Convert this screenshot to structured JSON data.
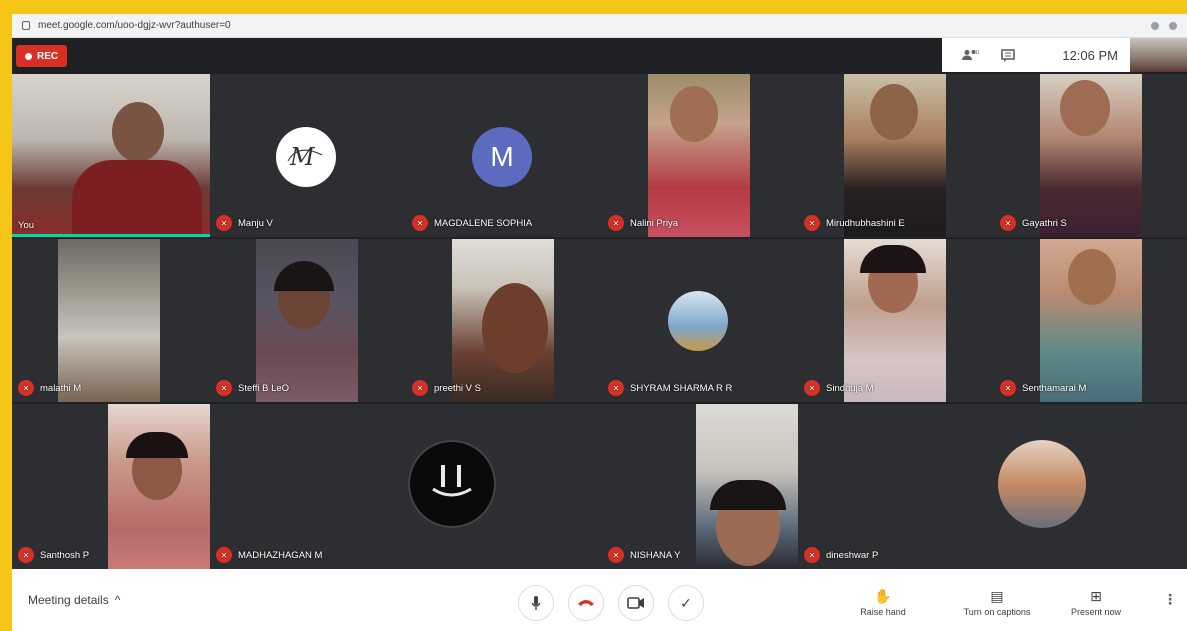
{
  "browser": {
    "url": "meet.google.com/uoo-dgjz-wvr?authuser=0"
  },
  "topbar": {
    "rec_label": "REC",
    "time": "12:06 PM"
  },
  "participants": [
    {
      "name": "You",
      "type": "video"
    },
    {
      "name": "Manju V",
      "type": "logo"
    },
    {
      "name": "MAGDALENE SOPHIA",
      "type": "initial",
      "initial": "M",
      "color": "#5c6bc0"
    },
    {
      "name": "Nalini Priya",
      "type": "video"
    },
    {
      "name": "Mirudhubhashini E",
      "type": "video"
    },
    {
      "name": "Gayathri S",
      "type": "video"
    },
    {
      "name": "malathi M",
      "type": "video"
    },
    {
      "name": "Steffi B LeO",
      "type": "video"
    },
    {
      "name": "preethi V S",
      "type": "video"
    },
    {
      "name": "SHYRAM SHARMA R R",
      "type": "photo-avatar"
    },
    {
      "name": "Sindhuja M",
      "type": "video"
    },
    {
      "name": "Senthamarai M",
      "type": "video"
    },
    {
      "name": "Santhosh P",
      "type": "video"
    },
    {
      "name": "MADHAZHAGAN M",
      "type": "logo-dark"
    },
    {
      "name": "NISHANA Y",
      "type": "video"
    },
    {
      "name": "dineshwar P",
      "type": "photo-avatar"
    }
  ],
  "bottom": {
    "meeting_details": "Meeting details",
    "raise_hand": "Raise hand",
    "captions": "Turn on captions",
    "present": "Present now"
  },
  "colors": {
    "frame": "#f5c518",
    "bg": "#202124",
    "mic_off": "#d93025",
    "active_speaker": "#00d9a3"
  }
}
